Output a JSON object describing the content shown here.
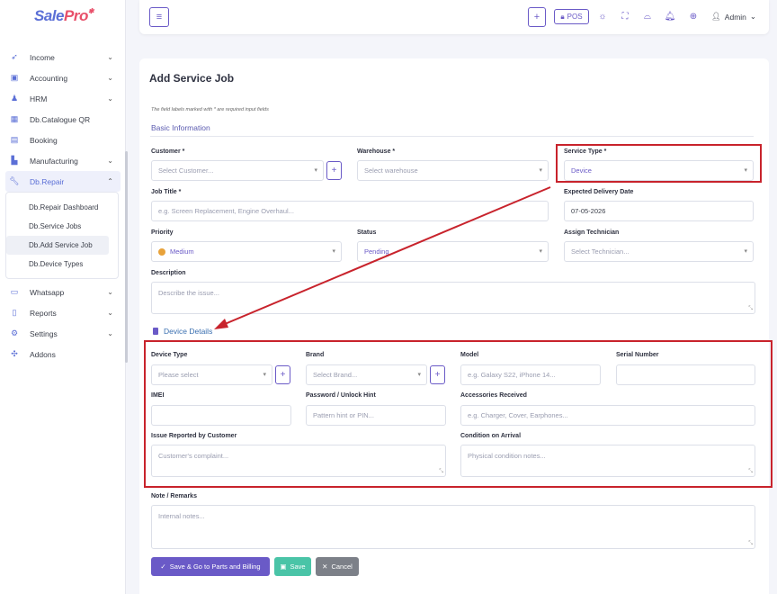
{
  "brand": {
    "logo_main": "Sale",
    "logo_accent": "Pro",
    "accent_color": "#6a5ac7",
    "highlight_color": "#c8232c"
  },
  "sidebar": {
    "items": [
      {
        "label": "Income",
        "icon": "rocket-icon"
      },
      {
        "label": "Accounting",
        "icon": "briefcase-icon"
      },
      {
        "label": "HRM",
        "icon": "users-icon"
      },
      {
        "label": "Db.Catalogue QR",
        "icon": "qr-icon"
      },
      {
        "label": "Booking",
        "icon": "calendar-icon"
      },
      {
        "label": "Manufacturing",
        "icon": "factory-icon"
      },
      {
        "label": "Db.Repair",
        "icon": "wrench-icon"
      }
    ],
    "repair_sub": [
      "Db.Repair Dashboard",
      "Db.Service Jobs",
      "Db.Add Service Job",
      "Db.Device Types"
    ],
    "items_after": [
      {
        "label": "Whatsapp",
        "icon": "chat-icon"
      },
      {
        "label": "Reports",
        "icon": "document-icon"
      },
      {
        "label": "Settings",
        "icon": "gear-icon"
      },
      {
        "label": "Addons",
        "icon": "puzzle-icon"
      }
    ]
  },
  "topbar": {
    "pos_label": "POS",
    "user_label": "Admin"
  },
  "page": {
    "title": "Add Service Job",
    "required_note": "The field labels marked with * are required input fields",
    "basic_section": "Basic Information",
    "device_section": "Device Details"
  },
  "form": {
    "customer": {
      "label": "Customer *",
      "placeholder": "Select Customer..."
    },
    "warehouse": {
      "label": "Warehouse *",
      "placeholder": "Select warehouse"
    },
    "service_type": {
      "label": "Service Type *",
      "value": "Device"
    },
    "job_title": {
      "label": "Job Title *",
      "placeholder": "e.g. Screen Replacement, Engine Overhaul..."
    },
    "delivery_date": {
      "label": "Expected Delivery Date",
      "value": "07-05-2026"
    },
    "priority": {
      "label": "Priority",
      "value": "Medium"
    },
    "status": {
      "label": "Status",
      "value": "Pending"
    },
    "technician": {
      "label": "Assign Technician",
      "placeholder": "Select Technician..."
    },
    "description": {
      "label": "Description",
      "placeholder": "Describe the issue..."
    },
    "device_type": {
      "label": "Device Type",
      "placeholder": "Please select"
    },
    "brand": {
      "label": "Brand",
      "placeholder": "Select Brand..."
    },
    "model": {
      "label": "Model",
      "placeholder": "e.g. Galaxy S22, iPhone 14..."
    },
    "serial": {
      "label": "Serial Number",
      "placeholder": ""
    },
    "imei": {
      "label": "IMEI",
      "placeholder": ""
    },
    "password": {
      "label": "Password / Unlock Hint",
      "placeholder": "Pattern hint or PIN..."
    },
    "accessories": {
      "label": "Accessories Received",
      "placeholder": "e.g. Charger, Cover, Earphones..."
    },
    "issue": {
      "label": "Issue Reported by Customer",
      "placeholder": "Customer's complaint..."
    },
    "condition": {
      "label": "Condition on Arrival",
      "placeholder": "Physical condition notes..."
    },
    "remarks": {
      "label": "Note / Remarks",
      "placeholder": "Internal notes..."
    }
  },
  "actions": {
    "primary": "Save & Go to Parts and Billing",
    "save": "Save",
    "cancel": "Cancel"
  }
}
